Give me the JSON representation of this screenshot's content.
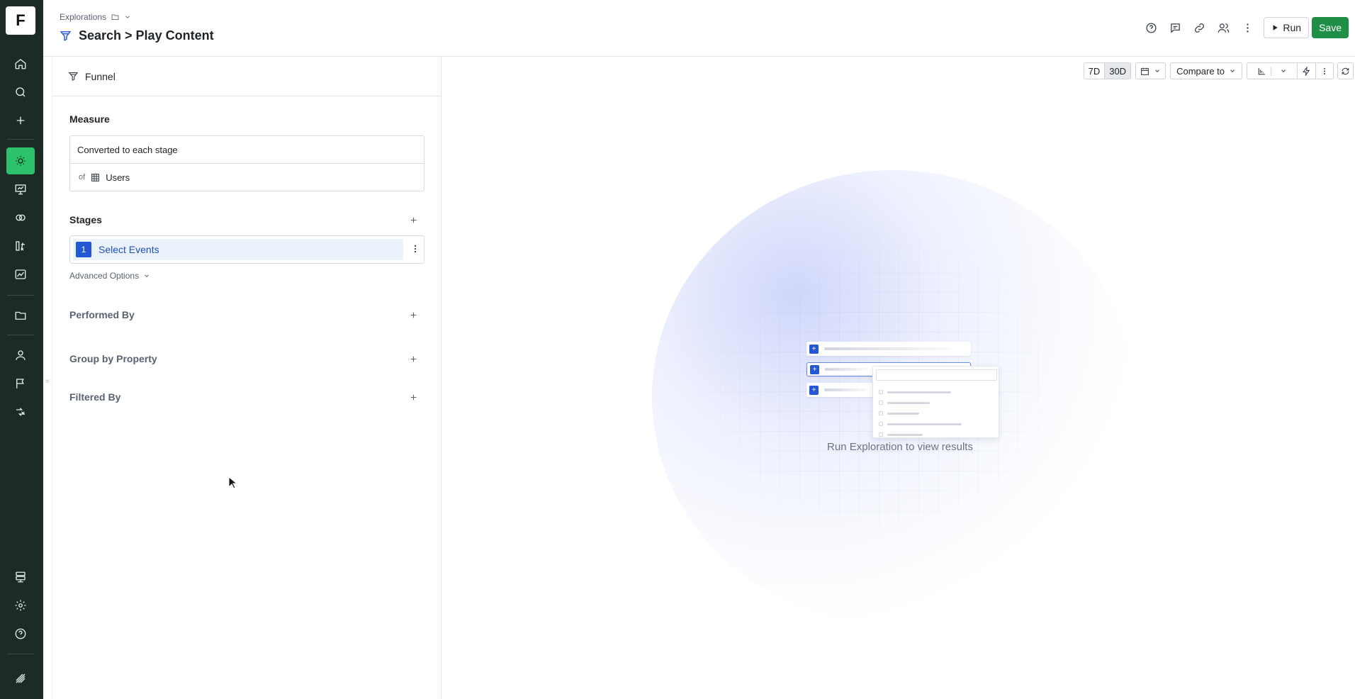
{
  "app": {
    "logo_letter": "F",
    "accent_color": "#2bc26b",
    "primary_blue": "#2357d6",
    "save_color": "#1f8f47"
  },
  "rail": {
    "items": [
      {
        "name": "home-icon"
      },
      {
        "name": "search-icon"
      },
      {
        "name": "plus-icon"
      },
      {
        "name": "lightbulb-icon",
        "active": true
      },
      {
        "name": "presentation-icon"
      },
      {
        "name": "link-rings-icon"
      },
      {
        "name": "formula-icon"
      },
      {
        "name": "chart-icon"
      },
      {
        "name": "folder-icon"
      },
      {
        "name": "user-icon"
      },
      {
        "name": "flag-icon"
      },
      {
        "name": "experiment-icon"
      },
      {
        "name": "database-icon"
      },
      {
        "name": "gear-icon"
      },
      {
        "name": "help-icon"
      },
      {
        "name": "brand-icon"
      }
    ]
  },
  "header": {
    "breadcrumb": "Explorations",
    "title": "Search > Play Content",
    "run_label": "Run",
    "save_label": "Save"
  },
  "panel": {
    "tab_label": "Funnel",
    "measure": {
      "label": "Measure",
      "value": "Converted to each stage",
      "of_label": "of",
      "entity": "Users"
    },
    "stages": {
      "label": "Stages",
      "items": [
        {
          "number": "1",
          "label": "Select Events"
        }
      ]
    },
    "advanced_label": "Advanced Options",
    "performed_by_label": "Performed By",
    "group_by_label": "Group by Property",
    "filtered_by_label": "Filtered By"
  },
  "toolbar": {
    "range_7d": "7D",
    "range_30d": "30D",
    "compare_label": "Compare to"
  },
  "main": {
    "empty_message": "Run Exploration to view results"
  }
}
